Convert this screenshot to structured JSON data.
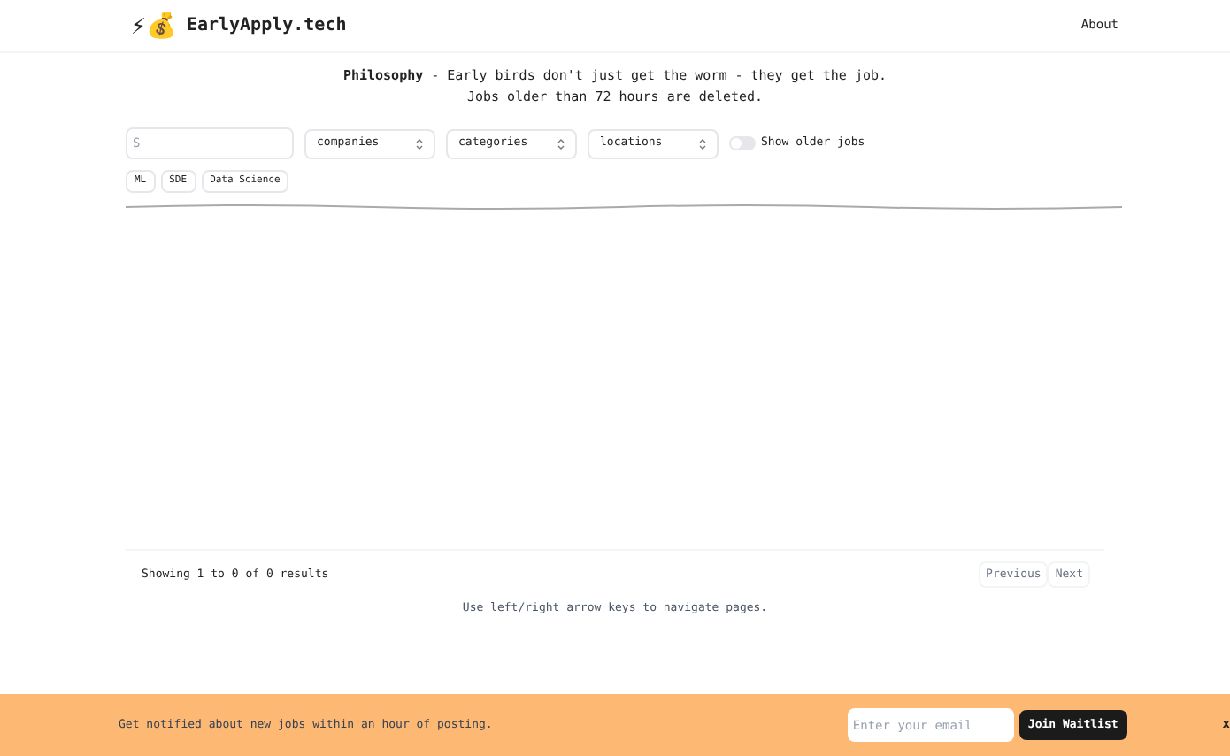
{
  "header": {
    "logo_emoji": "⚡💰",
    "brand": "EarlyApply.tech",
    "nav": [
      "About"
    ]
  },
  "intro": {
    "line_1": "**Philosophy** - Early birds don't just get the worm - they get the job.",
    "line_2": "Jobs older than 72 hours are deleted."
  },
  "filters": {
    "search": {
      "placeholder": "S"
    },
    "selects": [
      "companies",
      "categories",
      "locations"
    ],
    "toggle": {
      "label": "Show older jobs",
      "on": false
    }
  },
  "tags": [
    "ML",
    "SDE",
    "Data Science"
  ],
  "pagination": {
    "summary": "Showing 1 to 0 of 0 results",
    "buttons": [
      "Previous",
      "Next"
    ],
    "hint": "Use left/right arrow keys to navigate pages."
  },
  "banner": {
    "text": "Get notified about new jobs within an hour of posting.",
    "email": {
      "placeholder": "Enter your email"
    },
    "button": "Join Waitlist",
    "close": "x"
  }
}
